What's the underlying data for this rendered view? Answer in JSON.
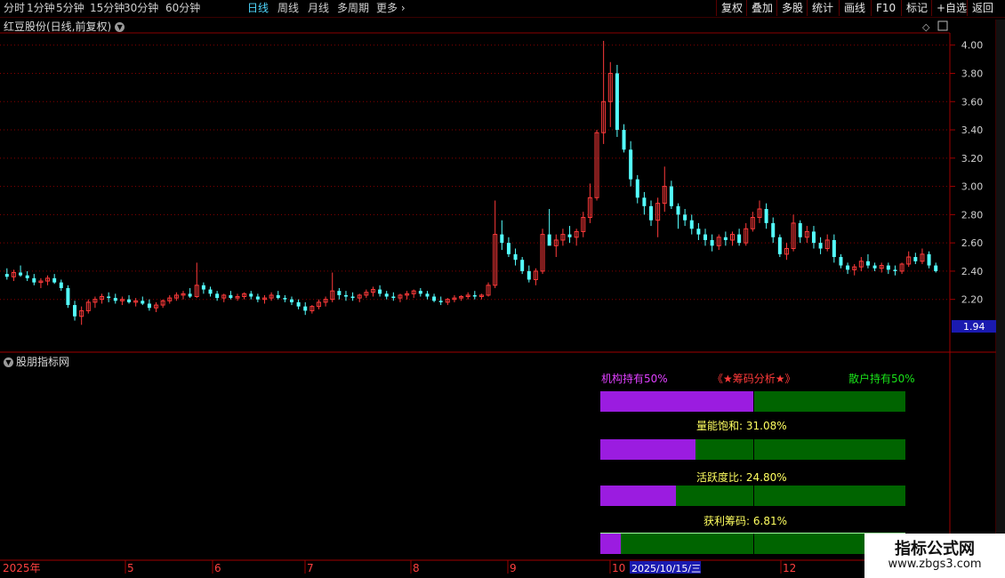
{
  "toolbar": {
    "periods": [
      "分时",
      "1分钟",
      "5分钟",
      "15分钟",
      "30分钟",
      "60分钟",
      "日线",
      "周线",
      "月线",
      "多周期",
      "更多"
    ],
    "active_period": "日线",
    "right_buttons": [
      "复权",
      "叠加",
      "多股",
      "统计",
      "画线",
      "F10",
      "标记",
      "+自选",
      "返回"
    ]
  },
  "symbol_title": "红豆股份(日线,前复权)",
  "indicator_name": "股朋指标网",
  "price_axis": {
    "ticks": [
      "4.00",
      "3.80",
      "3.60",
      "3.40",
      "3.20",
      "3.00",
      "2.80",
      "2.60",
      "2.40",
      "2.20"
    ],
    "current_label": "1.94"
  },
  "date_axis": {
    "labels": [
      "2025年",
      "5",
      "6",
      "7",
      "8",
      "9",
      "10",
      "12"
    ],
    "cursor_label": "2025/10/15/三"
  },
  "chip_panel": {
    "inst_label": "机构持有50%",
    "title": "《★筹码分析★》",
    "retail_label": "散户持有50%",
    "rows": [
      {
        "label": "",
        "value": "",
        "fill": 0.5
      },
      {
        "label": "量能饱和:",
        "value": "31.08%",
        "fill": 0.3108
      },
      {
        "label": "活跃度比:",
        "value": "24.80%",
        "fill": 0.248
      },
      {
        "label": "获利筹码:",
        "value": "6.81%",
        "fill": 0.0681
      }
    ]
  },
  "colors": {
    "up": "#ff3a3a",
    "down": "#54ffff",
    "grid": "#8a0000",
    "inst": "#9b1ce0",
    "retail": "#006400"
  },
  "watermark": {
    "line1": "指标公式网",
    "line2": "www.zbgs3.com"
  },
  "chart_data": {
    "type": "candlestick",
    "title": "红豆股份(日线,前复权)",
    "y_range": [
      1.94,
      4.08
    ],
    "candles": [
      [
        2.38,
        2.42,
        2.34,
        2.36
      ],
      [
        2.36,
        2.41,
        2.33,
        2.39
      ],
      [
        2.39,
        2.44,
        2.36,
        2.37
      ],
      [
        2.37,
        2.4,
        2.33,
        2.35
      ],
      [
        2.35,
        2.38,
        2.3,
        2.32
      ],
      [
        2.32,
        2.35,
        2.28,
        2.33
      ],
      [
        2.33,
        2.37,
        2.3,
        2.35
      ],
      [
        2.35,
        2.38,
        2.31,
        2.32
      ],
      [
        2.32,
        2.34,
        2.26,
        2.28
      ],
      [
        2.28,
        2.3,
        2.14,
        2.16
      ],
      [
        2.16,
        2.19,
        2.05,
        2.08
      ],
      [
        2.08,
        2.15,
        2.02,
        2.12
      ],
      [
        2.12,
        2.2,
        2.1,
        2.18
      ],
      [
        2.18,
        2.22,
        2.14,
        2.2
      ],
      [
        2.2,
        2.24,
        2.17,
        2.22
      ],
      [
        2.22,
        2.25,
        2.18,
        2.21
      ],
      [
        2.21,
        2.24,
        2.17,
        2.19
      ],
      [
        2.19,
        2.22,
        2.16,
        2.2
      ],
      [
        2.2,
        2.23,
        2.17,
        2.18
      ],
      [
        2.18,
        2.21,
        2.15,
        2.19
      ],
      [
        2.19,
        2.22,
        2.16,
        2.17
      ],
      [
        2.17,
        2.2,
        2.12,
        2.14
      ],
      [
        2.14,
        2.18,
        2.11,
        2.16
      ],
      [
        2.16,
        2.2,
        2.14,
        2.19
      ],
      [
        2.19,
        2.23,
        2.17,
        2.21
      ],
      [
        2.21,
        2.25,
        2.19,
        2.23
      ],
      [
        2.23,
        2.26,
        2.2,
        2.24
      ],
      [
        2.24,
        2.28,
        2.21,
        2.22
      ],
      [
        2.22,
        2.46,
        2.21,
        2.3
      ],
      [
        2.3,
        2.32,
        2.24,
        2.27
      ],
      [
        2.27,
        2.29,
        2.22,
        2.24
      ],
      [
        2.24,
        2.26,
        2.19,
        2.21
      ],
      [
        2.21,
        2.24,
        2.18,
        2.23
      ],
      [
        2.23,
        2.26,
        2.2,
        2.21
      ],
      [
        2.21,
        2.24,
        2.19,
        2.22
      ],
      [
        2.22,
        2.25,
        2.2,
        2.24
      ],
      [
        2.24,
        2.26,
        2.2,
        2.22
      ],
      [
        2.22,
        2.24,
        2.18,
        2.2
      ],
      [
        2.2,
        2.23,
        2.17,
        2.21
      ],
      [
        2.21,
        2.25,
        2.19,
        2.23
      ],
      [
        2.23,
        2.26,
        2.2,
        2.21
      ],
      [
        2.21,
        2.23,
        2.18,
        2.2
      ],
      [
        2.2,
        2.22,
        2.16,
        2.18
      ],
      [
        2.18,
        2.2,
        2.13,
        2.15
      ],
      [
        2.15,
        2.18,
        2.09,
        2.12
      ],
      [
        2.12,
        2.16,
        2.1,
        2.15
      ],
      [
        2.15,
        2.2,
        2.13,
        2.18
      ],
      [
        2.18,
        2.22,
        2.15,
        2.2
      ],
      [
        2.2,
        2.39,
        2.18,
        2.26
      ],
      [
        2.26,
        2.28,
        2.2,
        2.23
      ],
      [
        2.23,
        2.26,
        2.19,
        2.22
      ],
      [
        2.22,
        2.25,
        2.19,
        2.21
      ],
      [
        2.21,
        2.24,
        2.18,
        2.23
      ],
      [
        2.23,
        2.27,
        2.21,
        2.25
      ],
      [
        2.25,
        2.29,
        2.22,
        2.27
      ],
      [
        2.27,
        2.3,
        2.22,
        2.24
      ],
      [
        2.24,
        2.26,
        2.2,
        2.22
      ],
      [
        2.22,
        2.25,
        2.19,
        2.21
      ],
      [
        2.21,
        2.24,
        2.18,
        2.23
      ],
      [
        2.23,
        2.26,
        2.2,
        2.24
      ],
      [
        2.24,
        2.27,
        2.21,
        2.26
      ],
      [
        2.26,
        2.28,
        2.22,
        2.24
      ],
      [
        2.24,
        2.26,
        2.2,
        2.22
      ],
      [
        2.22,
        2.24,
        2.18,
        2.19
      ],
      [
        2.19,
        2.22,
        2.16,
        2.18
      ],
      [
        2.18,
        2.21,
        2.16,
        2.2
      ],
      [
        2.2,
        2.23,
        2.18,
        2.21
      ],
      [
        2.21,
        2.23,
        2.19,
        2.22
      ],
      [
        2.22,
        2.25,
        2.2,
        2.23
      ],
      [
        2.23,
        2.26,
        2.2,
        2.22
      ],
      [
        2.22,
        2.24,
        2.2,
        2.23
      ],
      [
        2.23,
        2.32,
        2.22,
        2.3
      ],
      [
        2.3,
        2.9,
        2.28,
        2.66
      ],
      [
        2.66,
        2.76,
        2.55,
        2.6
      ],
      [
        2.6,
        2.64,
        2.5,
        2.52
      ],
      [
        2.52,
        2.56,
        2.44,
        2.48
      ],
      [
        2.48,
        2.5,
        2.38,
        2.4
      ],
      [
        2.4,
        2.44,
        2.32,
        2.34
      ],
      [
        2.34,
        2.42,
        2.3,
        2.4
      ],
      [
        2.4,
        2.7,
        2.38,
        2.66
      ],
      [
        2.66,
        2.84,
        2.6,
        2.58
      ],
      [
        2.58,
        2.66,
        2.5,
        2.62
      ],
      [
        2.62,
        2.7,
        2.58,
        2.66
      ],
      [
        2.66,
        2.72,
        2.6,
        2.64
      ],
      [
        2.64,
        2.7,
        2.58,
        2.68
      ],
      [
        2.68,
        2.82,
        2.64,
        2.78
      ],
      [
        2.78,
        3.02,
        2.74,
        2.92
      ],
      [
        2.92,
        3.4,
        2.9,
        3.38
      ],
      [
        3.38,
        4.03,
        3.3,
        3.6
      ],
      [
        3.6,
        3.88,
        3.42,
        3.8
      ],
      [
        3.8,
        3.86,
        3.35,
        3.4
      ],
      [
        3.4,
        3.44,
        3.24,
        3.26
      ],
      [
        3.26,
        3.32,
        3.0,
        3.05
      ],
      [
        3.05,
        3.08,
        2.88,
        2.92
      ],
      [
        2.92,
        2.96,
        2.8,
        2.86
      ],
      [
        2.86,
        2.9,
        2.72,
        2.76
      ],
      [
        2.76,
        2.92,
        2.64,
        2.88
      ],
      [
        2.88,
        3.14,
        2.82,
        3.0
      ],
      [
        3.0,
        3.04,
        2.84,
        2.86
      ],
      [
        2.86,
        2.88,
        2.7,
        2.8
      ],
      [
        2.8,
        2.84,
        2.72,
        2.76
      ],
      [
        2.76,
        2.8,
        2.66,
        2.7
      ],
      [
        2.7,
        2.74,
        2.62,
        2.66
      ],
      [
        2.66,
        2.7,
        2.58,
        2.62
      ],
      [
        2.62,
        2.66,
        2.54,
        2.58
      ],
      [
        2.58,
        2.66,
        2.55,
        2.64
      ],
      [
        2.64,
        2.68,
        2.58,
        2.62
      ],
      [
        2.62,
        2.68,
        2.58,
        2.66
      ],
      [
        2.66,
        2.7,
        2.58,
        2.6
      ],
      [
        2.6,
        2.74,
        2.58,
        2.7
      ],
      [
        2.7,
        2.82,
        2.68,
        2.78
      ],
      [
        2.78,
        2.9,
        2.74,
        2.84
      ],
      [
        2.84,
        2.88,
        2.7,
        2.74
      ],
      [
        2.74,
        2.78,
        2.6,
        2.64
      ],
      [
        2.64,
        2.66,
        2.5,
        2.52
      ],
      [
        2.52,
        2.6,
        2.48,
        2.56
      ],
      [
        2.56,
        2.8,
        2.54,
        2.74
      ],
      [
        2.74,
        2.76,
        2.6,
        2.64
      ],
      [
        2.64,
        2.72,
        2.6,
        2.68
      ],
      [
        2.68,
        2.72,
        2.56,
        2.6
      ],
      [
        2.6,
        2.64,
        2.52,
        2.56
      ],
      [
        2.56,
        2.66,
        2.54,
        2.62
      ],
      [
        2.62,
        2.66,
        2.46,
        2.5
      ],
      [
        2.5,
        2.52,
        2.42,
        2.44
      ],
      [
        2.44,
        2.46,
        2.38,
        2.41
      ],
      [
        2.41,
        2.45,
        2.37,
        2.43
      ],
      [
        2.43,
        2.5,
        2.4,
        2.47
      ],
      [
        2.47,
        2.52,
        2.42,
        2.44
      ],
      [
        2.44,
        2.46,
        2.4,
        2.42
      ],
      [
        2.42,
        2.46,
        2.39,
        2.44
      ],
      [
        2.44,
        2.46,
        2.38,
        2.41
      ],
      [
        2.41,
        2.44,
        2.37,
        2.4
      ],
      [
        2.4,
        2.46,
        2.38,
        2.45
      ],
      [
        2.45,
        2.54,
        2.43,
        2.5
      ],
      [
        2.5,
        2.53,
        2.45,
        2.47
      ],
      [
        2.47,
        2.56,
        2.45,
        2.52
      ],
      [
        2.52,
        2.54,
        2.42,
        2.44
      ],
      [
        2.44,
        2.46,
        2.39,
        2.4
      ]
    ],
    "last_close": 2.4
  }
}
